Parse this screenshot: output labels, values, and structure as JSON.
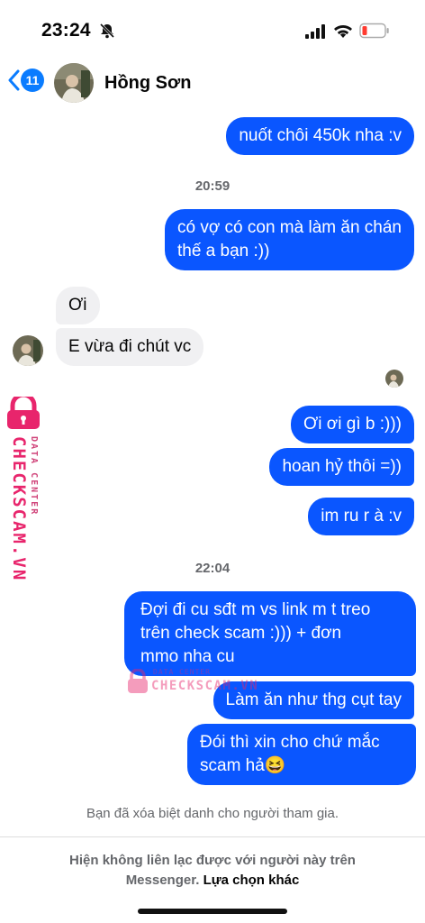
{
  "status_bar": {
    "time": "23:24"
  },
  "header": {
    "back_count": "11",
    "contact_name": "Hồng Sơn"
  },
  "messages": {
    "m1": "nuốt chôi 450k nha :v",
    "ts1": "20:59",
    "m2_line1": "có vợ có con mà làm ăn chán",
    "m2_line2": "thế a bạn :))",
    "m3": "Ơi",
    "m4": "E vừa đi chút vc",
    "m5": "Ơi ơi gì b :)))",
    "m6": "hoan hỷ thôi =))",
    "m7": "im ru r à :v",
    "ts2": "22:04",
    "m8_line1": "Đợi đi cu sđt m vs link m t treo",
    "m8_line2": "trên check scam :))) + đơn",
    "m8_line3": "mmo nha cu",
    "m9": "Làm ăn như thg cụt tay",
    "m10_line1": "Đói thì xin cho chứ mắc",
    "m10_line2": "scam hả😆"
  },
  "watermark": {
    "brand": "CHECKSCAM.VN",
    "tagline": "DATA CENTER"
  },
  "system_note": "Bạn đã xóa biệt danh cho người tham gia.",
  "footer": {
    "line1": "Hiện không liên lạc được với người này trên",
    "line2_prefix": "Messenger. ",
    "link": "Lựa chọn khác"
  },
  "colors": {
    "outgoing": "#0a56ff",
    "incoming": "#f0f0f2",
    "accent": "#0a7cff",
    "watermark": "#e8256c"
  }
}
